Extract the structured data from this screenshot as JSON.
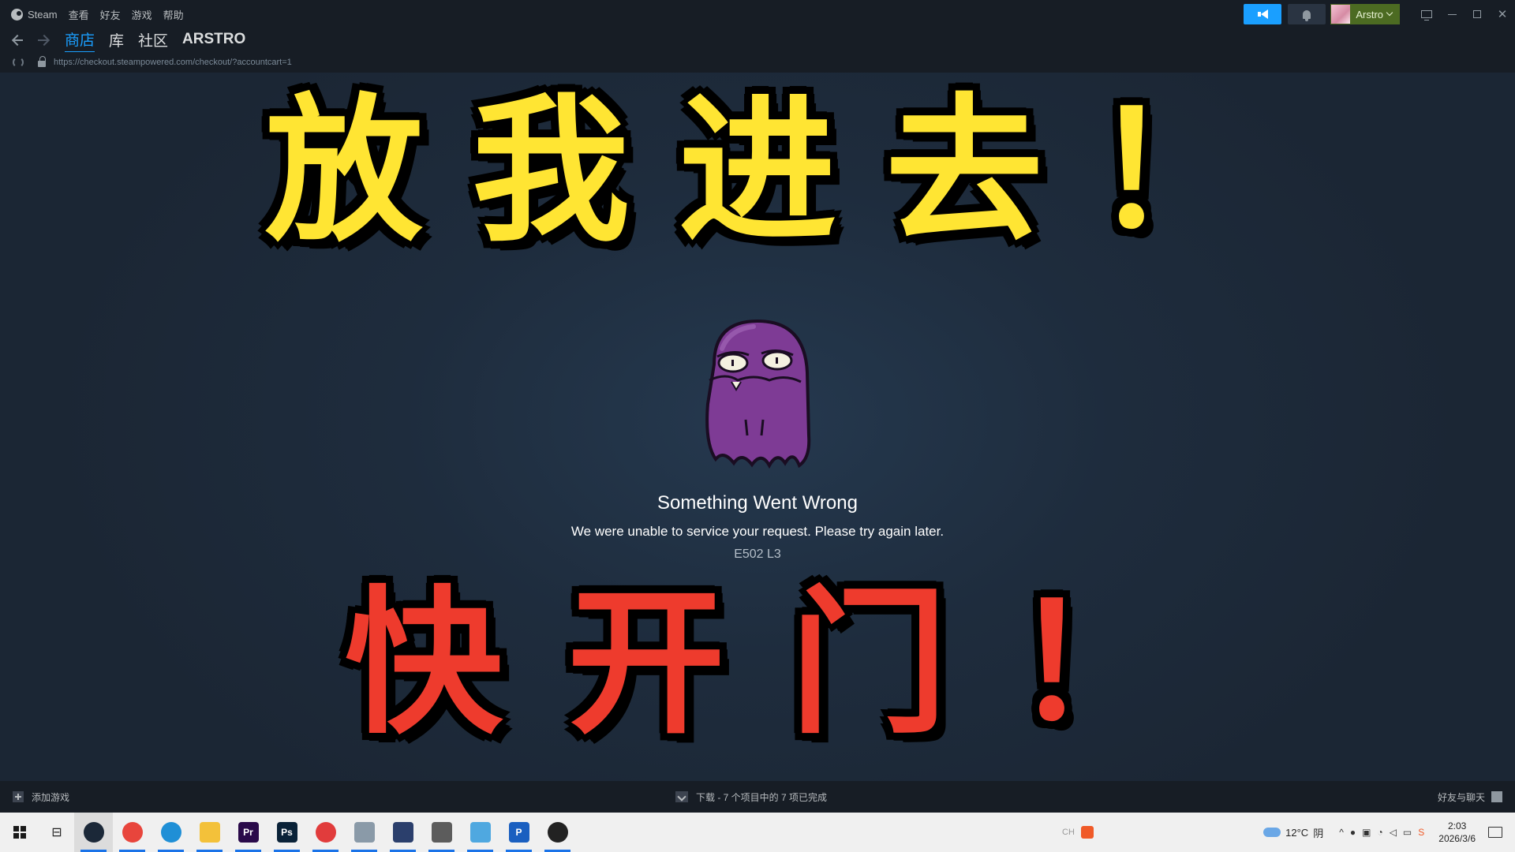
{
  "menubar": {
    "app_name": "Steam",
    "items": [
      "查看",
      "好友",
      "游戏",
      "帮助"
    ],
    "user_name": "Arstro"
  },
  "nav": {
    "tabs": [
      {
        "label": "商店",
        "active": true
      },
      {
        "label": "库",
        "active": false
      },
      {
        "label": "社区",
        "active": false
      },
      {
        "label": "ARSTRO",
        "active": false
      }
    ]
  },
  "urlbar": {
    "url": "https://checkout.steampowered.com/checkout/?accountcart=1"
  },
  "overlay": {
    "top_text": "放我进去！",
    "bottom_text": "快开门！"
  },
  "error": {
    "title": "Something Went Wrong",
    "message": "We were unable to service your request. Please try again later.",
    "code": "E502 L3"
  },
  "statusbar": {
    "add_game": "添加游戏",
    "downloads": "下载 - 7 个项目中的 7 项已完成",
    "friends": "好友与聊天"
  },
  "taskbar": {
    "apps": [
      {
        "name": "steam-app",
        "label": "",
        "color": "#1b2838",
        "active": true
      },
      {
        "name": "chrome-app",
        "label": "",
        "color": "#e8453c",
        "active": false
      },
      {
        "name": "edge-app",
        "label": "",
        "color": "#1f8fd6",
        "active": false
      },
      {
        "name": "explorer-app",
        "label": "",
        "color": "#f3c13a",
        "active": false
      },
      {
        "name": "premiere-app",
        "label": "Pr",
        "color": "#2a0a4a",
        "active": false
      },
      {
        "name": "photoshop-app",
        "label": "Ps",
        "color": "#0a2238",
        "active": false
      },
      {
        "name": "netease-music-app",
        "label": "",
        "color": "#e13c3c",
        "active": false
      },
      {
        "name": "app-generic-1",
        "label": "",
        "color": "#8a9aa8",
        "active": false
      },
      {
        "name": "app-generic-2",
        "label": "",
        "color": "#2b3f6c",
        "active": false
      },
      {
        "name": "app-generic-3",
        "label": "",
        "color": "#5c5c5c",
        "active": false
      },
      {
        "name": "app-generic-4",
        "label": "",
        "color": "#4fa8e0",
        "active": false
      },
      {
        "name": "app-generic-5",
        "label": "P",
        "color": "#1a5fc0",
        "active": false
      },
      {
        "name": "app-generic-6",
        "label": "",
        "color": "#222222",
        "active": false
      }
    ],
    "weather_temp": "12°C",
    "weather_desc": "阴",
    "time": "2:03",
    "date": "2026/3/6"
  },
  "colors": {
    "accent": "#1a9fff",
    "user_chip": "#4c6b22",
    "overlay_top": "#ffe533",
    "overlay_bottom": "#ee3b2d"
  }
}
